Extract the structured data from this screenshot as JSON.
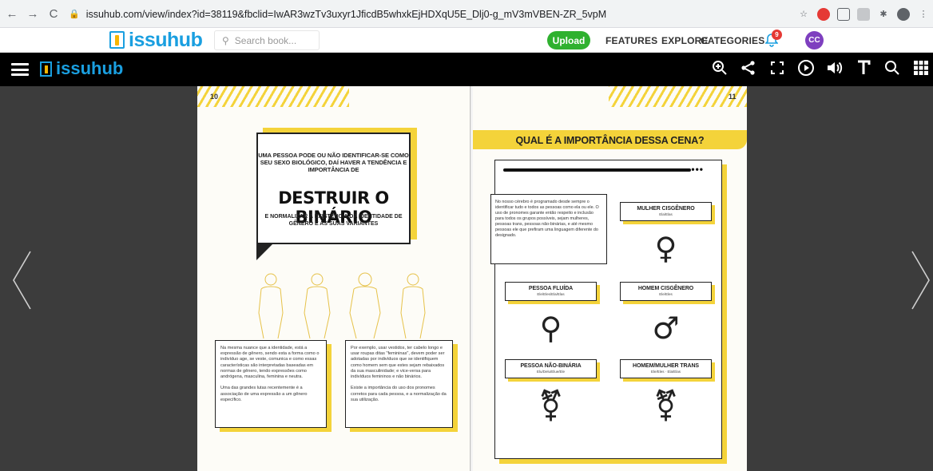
{
  "browser": {
    "back": "←",
    "forward": "→",
    "reload": "C",
    "url": "issuhub.com/view/index?id=38119&fbclid=IwAR3wzTv3uxyr1JficdB5whxkEjHDXqU5E_Dlj0-g_mV3mVBEN-ZR_5vpM"
  },
  "site": {
    "logo_text": "issuhub",
    "search_placeholder": "Search book...",
    "upload_label": "Upload",
    "menu": [
      "FEATURES",
      "EXPLORE",
      "CATEGORIES"
    ],
    "notification_count": "9",
    "avatar_initials": "CC"
  },
  "viewer": {
    "logo_text": "issuhub"
  },
  "left_page": {
    "page_number": "10",
    "bubble_top": "UMA PESSOA PODE OU NÃO IDENTIFICAR-SE COMO SEU SEXO BIOLÓGICO, DAÍ HAVER A TENDÊNCIA E IMPORTÂNCIA DE",
    "bubble_big": "DESTRUIR O BINÁRIO",
    "bubble_bottom": "E NORMALIZAR A EXISTÊNCIA DA IDENTIDADE DE GÊNERO E AS SUAS VARIANTES",
    "box1": "Na mesma nuance que a identidade, está a expressão de gênero, sendo esta a forma como o indivíduo age, se veste, comunica e como essas características são interpretadas baseadas em normas de gênero, tendo expressões como andrógena, masculina, feminina e neutra.\n\nUma das grandes lutas recentemente é a associação de uma expressão a um gênero específico.",
    "box2": "Por exemplo, usar vestidos, ter cabelo longo e usar roupas ditas \"femininas\", devem poder ser adotadas por indivíduos que se identifiquem como homem sem que estes sejam rebaixados da sua masculinidade; e vice-versa para indivíduos femininos e não binários.\n\nExiste a importância do uso dos pronomes corretos para cada pessoa, e a normalização da sua utilização."
  },
  "right_page": {
    "page_number": "11",
    "title": "QUAL É A IMPORTÂNCIA DESSA CENA?",
    "dots": "•••",
    "intro": "No nosso cérebro é programado desde sempre o identificar tudo e todos as pessoas como ela ou ele. O uso de pronomes garante então respeito e inclusão para todos os grupos possíveis, sejam mulheres, pessoas trans, pessoas não-binárias, e até mesmo pessoas ele que prefiram uma linguagem diferente do designado.",
    "cards": [
      {
        "title": "MULHER CISGÊNERO",
        "pronouns": "Ela/Elas",
        "symbol": "♀"
      },
      {
        "title": "PESSOA FLUÍDA",
        "pronouns": "Ele/Eles/Ela/Elas",
        "symbol": "⚲"
      },
      {
        "title": "HOMEM CISGÊNERO",
        "pronouns": "Ele/Eles",
        "symbol": "♂"
      },
      {
        "title": "PESSOA NÃO-BINÁRIA",
        "pronouns": "Elu/Delu/Elue/Ele",
        "symbol": "⚧"
      },
      {
        "title": "HOMEM/MULHER TRANS",
        "pronouns": "Ele/Eles · Ela/Elas",
        "symbol": "⚧"
      }
    ]
  },
  "colors": {
    "accent_yellow": "#f4d33a",
    "brand_blue": "#1a9fe0",
    "upload_green": "#2fb12f"
  }
}
